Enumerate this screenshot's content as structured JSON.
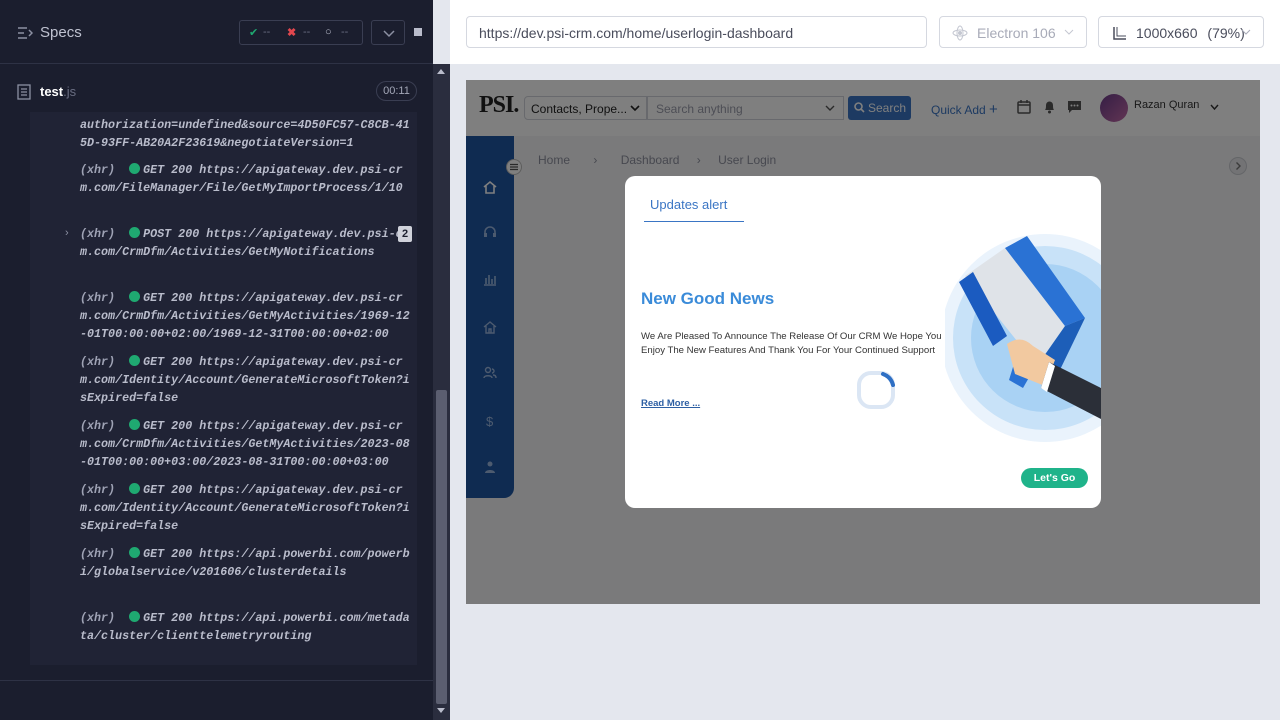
{
  "runner": {
    "title": "Specs",
    "stats": {
      "passed": "--",
      "failed": "--",
      "pending": "--"
    },
    "file": {
      "name": "test",
      "ext": ".js",
      "duration": "00:11"
    },
    "log": {
      "continuation": "authorization=undefined&source=4D50FC57-C8CB-415D-93FF-AB20A2F23619&negotiateVersion=1",
      "entries": [
        {
          "type": "(xhr)",
          "method": "GET 200",
          "url": "https://apigateway.dev.psi-crm.com/FileManager/File/GetMyImportProcess/1/10"
        },
        {
          "type": "(xhr)",
          "method": "POST 200",
          "url": "https://apigateway.dev.psi-crm.com/CrmDfm/Activities/GetMyNotifications",
          "count": "2"
        },
        {
          "type": "(xhr)",
          "method": "GET 200",
          "url": "https://apigateway.dev.psi-crm.com/CrmDfm/Activities/GetMyActivities/1969-12-01T00:00:00+02:00/1969-12-31T00:00:00+02:00"
        },
        {
          "type": "(xhr)",
          "method": "GET 200",
          "url": "https://apigateway.dev.psi-crm.com/Identity/Account/GenerateMicrosoftToken?isExpired=false"
        },
        {
          "type": "(xhr)",
          "method": "GET 200",
          "url": "https://apigateway.dev.psi-crm.com/CrmDfm/Activities/GetMyActivities/2023-08-01T00:00:00+03:00/2023-08-31T00:00:00+03:00"
        },
        {
          "type": "(xhr)",
          "method": "GET 200",
          "url": "https://apigateway.dev.psi-crm.com/Identity/Account/GenerateMicrosoftToken?isExpired=false"
        },
        {
          "type": "(xhr)",
          "method": "GET 200",
          "url": "https://api.powerbi.com/powerbi/globalservice/v201606/clusterdetails"
        },
        {
          "type": "(xhr)",
          "method": "GET 200",
          "url": "https://api.powerbi.com/metadata/cluster/clienttelemetryrouting"
        }
      ]
    }
  },
  "browser": {
    "url": "https://dev.psi-crm.com/home/userlogin-dashboard",
    "engine": "Electron 106",
    "viewport": "1000x660",
    "zoom": "(79%)"
  },
  "app": {
    "logo": "PSI.",
    "entity_select": "Contacts, Prope...",
    "search_placeholder": "Search anything",
    "search_button": "Search",
    "quick_add": "Quick Add",
    "user_name": "Razan Quran",
    "breadcrumb": [
      "Home",
      "Dashboard",
      "User Login"
    ]
  },
  "modal": {
    "tab": "Updates alert",
    "title": "New Good News",
    "body": "We Are Pleased To Announce The Release Of Our CRM We Hope You Enjoy The New Features And Thank You For Your Continued Support",
    "read_more": "Read More ...",
    "cta": "Let's Go"
  },
  "colors": {
    "brand_blue": "#3a75c4",
    "sidebar_blue": "#1e56a3",
    "success": "#1fa971",
    "cta": "#1fb38a"
  }
}
